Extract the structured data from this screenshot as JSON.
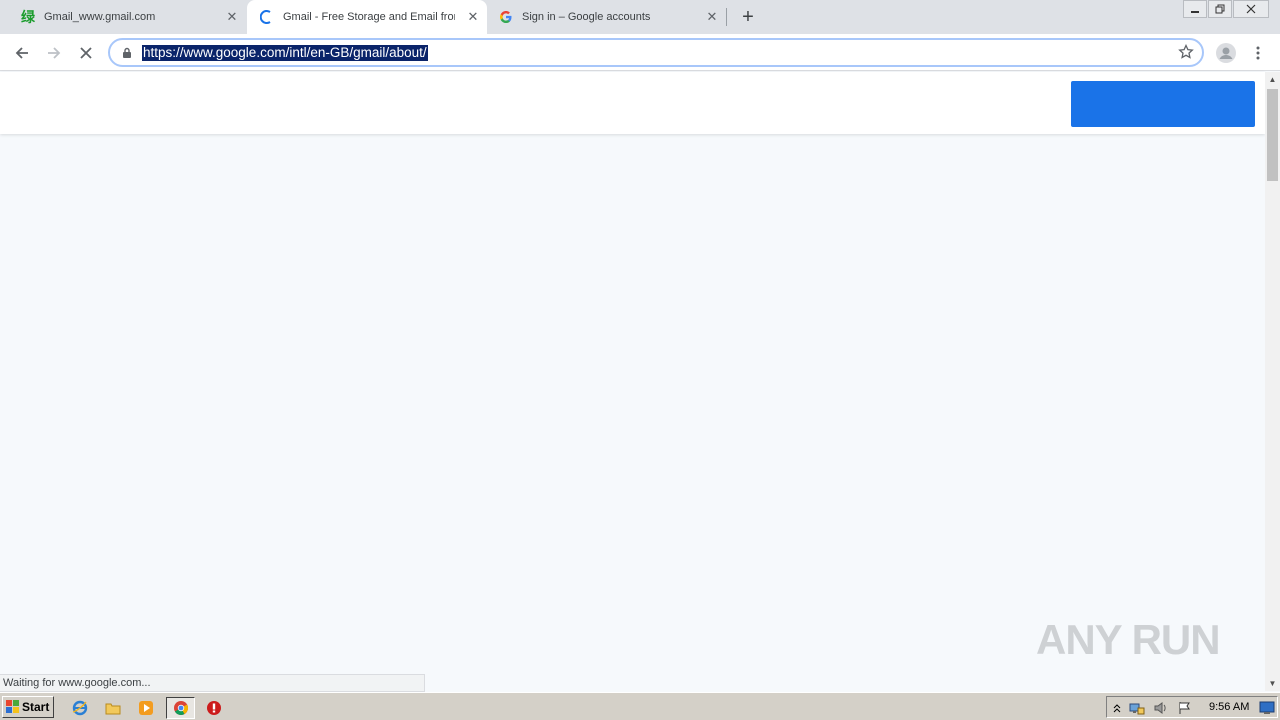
{
  "browser": {
    "tabs": [
      {
        "title": "Gmail_www.gmail.com",
        "icon": "green-chinese-char-icon",
        "glyph": "绿"
      },
      {
        "title": "Gmail - Free Storage and Email from",
        "icon": "loading-spinner-icon"
      },
      {
        "title": "Sign in – Google accounts",
        "icon": "google-g-icon"
      }
    ],
    "close_glyph": "✕",
    "new_tab_glyph": "+",
    "url": "https://www.google.com/intl/en-GB/gmail/about/"
  },
  "status_bar": {
    "text": "Waiting for www.google.com..."
  },
  "watermark": {
    "text": "ANY RUN"
  },
  "taskbar": {
    "start_label": "Start",
    "clock": "9:56 AM"
  },
  "colors": {
    "cta": "#1a73e8",
    "page_background": "#f6f9fc",
    "url_highlight": "#0a246a"
  }
}
